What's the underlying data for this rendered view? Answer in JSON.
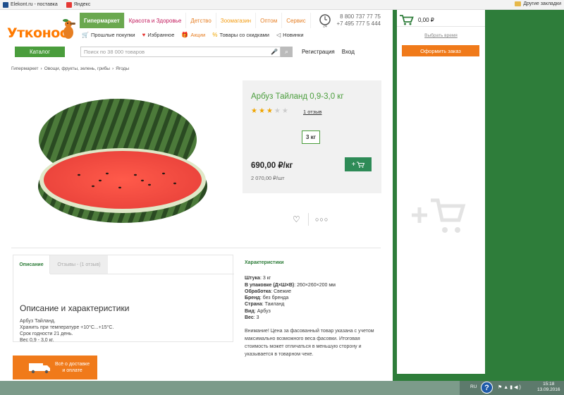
{
  "bookmarks": {
    "items": [
      {
        "label": "Elekont.ru - поставка",
        "color": "#1f4e8c"
      },
      {
        "label": "Яндекс",
        "color": "#e53935"
      }
    ],
    "other": "Другие закладки"
  },
  "header": {
    "logo": "Утконос",
    "nav": [
      "Гипермаркет",
      "Красота и Здоровье",
      "Детство",
      "Зоомагазин",
      "Оптом",
      "Сервис"
    ],
    "phone1": "8 800 737 77 75",
    "phone2": "+7 495 777 5 444",
    "clock_label": "24",
    "subnav": [
      {
        "icon": "cart-icon",
        "label": "Прошлые покупки"
      },
      {
        "icon": "heart-icon",
        "label": "Избранное"
      },
      {
        "icon": "gift-icon",
        "label": "Акции"
      },
      {
        "icon": "percent-icon",
        "label": "Товары со скидками"
      },
      {
        "icon": "new-icon",
        "label": "Новинки"
      }
    ],
    "catalog": "Каталог",
    "search_placeholder": "Поиск по 38 000 товаров",
    "register": "Регистрация",
    "login": "Вход"
  },
  "breadcrumb": [
    "Гипермаркет",
    "Овощи, фрукты, зелень, грибы",
    "Ягоды"
  ],
  "product": {
    "title": "Арбуз Тайланд 0,9-3,0 кг",
    "rating": 3,
    "rating_max": 5,
    "reviews": "1 отзыв",
    "weight": "3 кг",
    "price": "690,00 ₽/кг",
    "price_per_item": "2 070,00 ₽/шт",
    "add_label": "+"
  },
  "tabs": {
    "active": "Описание",
    "inactive": "Отзывы - (1 отзыв)"
  },
  "description": {
    "title": "Описание и характеристики",
    "lines": [
      "Арбуз Тайланд.",
      "Хранить при температуре +10°С...+15°С.",
      "Срок годности 21 день.",
      "Вес 0,9 - 3,0 кг."
    ]
  },
  "characteristics": {
    "title": "Характеристики",
    "rows": [
      {
        "k": "Штука",
        "v": "3 кг"
      },
      {
        "k": "В упаковке (Д×Ш×В)",
        "v": "260×260×200 мм"
      },
      {
        "k": "Обработка",
        "v": "Свежие"
      },
      {
        "k": "Бренд",
        "v": "без бренда"
      },
      {
        "k": "Страна",
        "v": "Таиланд"
      },
      {
        "k": "Вид",
        "v": "Арбуз"
      },
      {
        "k": "Вес",
        "v": "3"
      }
    ],
    "notice": "Внимание! Цена за фасованный товар указана с учетом максимально возможного веса фасовки. Итоговая стоимость может отличаться в меньшую сторону и указывается в товарном чеке."
  },
  "delivery": {
    "line1": "Всё о доставке",
    "line2": "и оплате"
  },
  "cart": {
    "sum": "0,00 ₽",
    "choose_time": "Выбрать время",
    "order": "Оформить заказ"
  },
  "taskbar": {
    "lang": "RU",
    "time": "15:18",
    "date": "13.09.2016"
  },
  "colors": {
    "green": "#4a9d3c",
    "orange": "#f07a1a",
    "dark_green": "#2e7d3a"
  }
}
